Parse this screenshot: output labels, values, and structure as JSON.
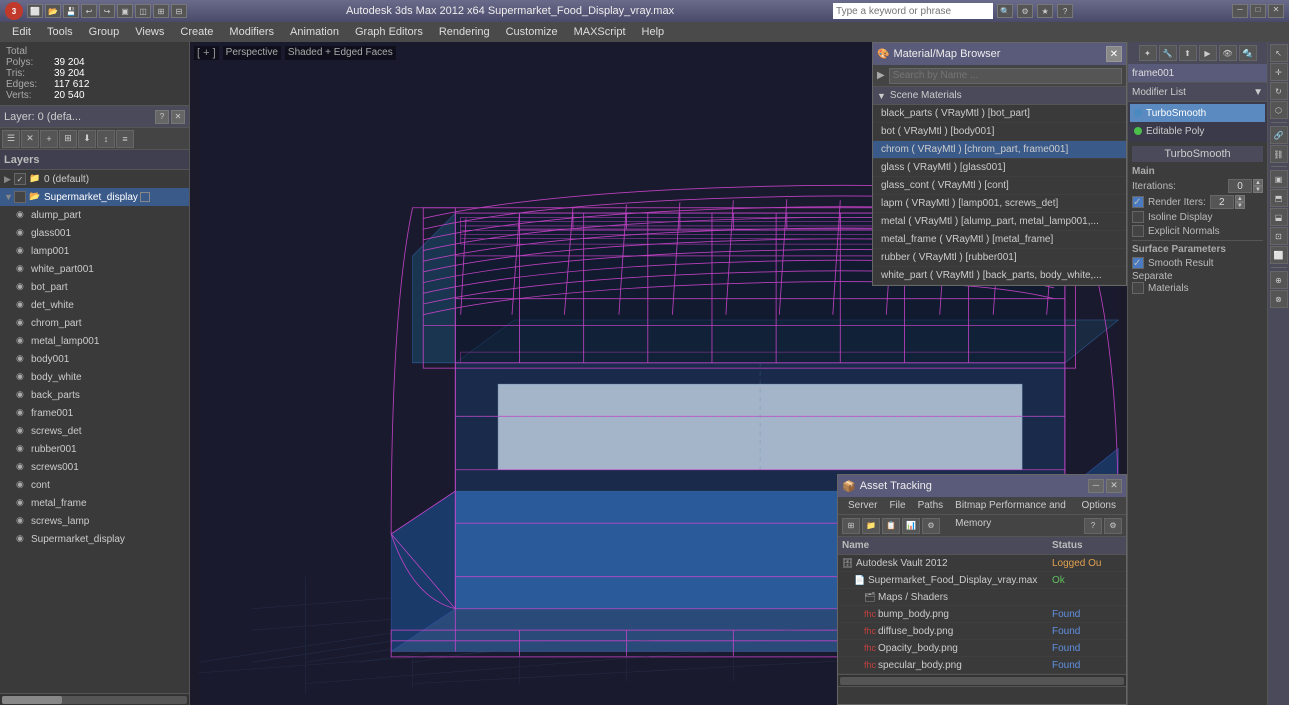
{
  "titlebar": {
    "title": "Autodesk 3ds Max  2012 x64      Supermarket_Food_Display_vray.max",
    "search_placeholder": "Type a keyword or phrase",
    "logo": "3",
    "min_btn": "─",
    "max_btn": "□",
    "close_btn": "✕"
  },
  "menubar": {
    "items": [
      "Edit",
      "Tools",
      "Group",
      "Views",
      "Create",
      "Modifiers",
      "Animation",
      "Graph Editors",
      "Rendering",
      "Customize",
      "MAXScript",
      "Help"
    ]
  },
  "viewport_label": {
    "perspective": "Perspective",
    "shading": "Shaded + Edged Faces",
    "bracket_open": "[ + ]"
  },
  "stats": {
    "total_label": "Total",
    "polys_label": "Polys:",
    "polys_value": "39 204",
    "tris_label": "Tris:",
    "tris_value": "39 204",
    "edges_label": "Edges:",
    "edges_value": "117 612",
    "verts_label": "Verts:",
    "verts_value": "20 540"
  },
  "layers_panel": {
    "title": "Layer: 0 (defa...",
    "question_btn": "?",
    "close_btn": "✕",
    "label": "Layers",
    "toolbar_btns": [
      "☰",
      "✕",
      "+",
      "⊞",
      "⬇",
      "↕",
      "≡"
    ],
    "items": [
      {
        "label": "0 (default)",
        "level": 0,
        "checked": true,
        "selected": false
      },
      {
        "label": "Supermarket_display",
        "level": 0,
        "checked": false,
        "selected": true
      },
      {
        "label": "alump_part",
        "level": 1,
        "checked": false,
        "selected": false
      },
      {
        "label": "glass001",
        "level": 1,
        "checked": false,
        "selected": false
      },
      {
        "label": "lamp001",
        "level": 1,
        "checked": false,
        "selected": false
      },
      {
        "label": "white_part001",
        "level": 1,
        "checked": false,
        "selected": false
      },
      {
        "label": "bot_part",
        "level": 1,
        "checked": false,
        "selected": false
      },
      {
        "label": "det_white",
        "level": 1,
        "checked": false,
        "selected": false
      },
      {
        "label": "chrom_part",
        "level": 1,
        "checked": false,
        "selected": false
      },
      {
        "label": "metal_lamp001",
        "level": 1,
        "checked": false,
        "selected": false
      },
      {
        "label": "body001",
        "level": 1,
        "checked": false,
        "selected": false
      },
      {
        "label": "body_white",
        "level": 1,
        "checked": false,
        "selected": false
      },
      {
        "label": "back_parts",
        "level": 1,
        "checked": false,
        "selected": false
      },
      {
        "label": "frame001",
        "level": 1,
        "checked": false,
        "selected": false
      },
      {
        "label": "screws_det",
        "level": 1,
        "checked": false,
        "selected": false
      },
      {
        "label": "rubber001",
        "level": 1,
        "checked": false,
        "selected": false
      },
      {
        "label": "screws001",
        "level": 1,
        "checked": false,
        "selected": false
      },
      {
        "label": "cont",
        "level": 1,
        "checked": false,
        "selected": false
      },
      {
        "label": "metal_frame",
        "level": 1,
        "checked": false,
        "selected": false
      },
      {
        "label": "screws_lamp",
        "level": 1,
        "checked": false,
        "selected": false
      },
      {
        "label": "Supermarket_display",
        "level": 1,
        "checked": false,
        "selected": false
      }
    ]
  },
  "right_panel": {
    "frame_label": "frame001",
    "modifier_list_label": "Modifier List",
    "modifiers": [
      {
        "label": "TurboSmooth",
        "selected": true,
        "dot_color": "blue"
      },
      {
        "label": "Editable Poly",
        "selected": false,
        "dot_color": "green"
      }
    ],
    "turbosmooth": {
      "title": "TurboSmooth",
      "main_label": "Main",
      "iterations_label": "Iterations:",
      "iterations_value": "0",
      "render_iters_label": "Render Iters:",
      "render_iters_value": "2",
      "isoline_display_label": "Isoline Display",
      "explicit_normals_label": "Explicit Normals",
      "surface_label": "Surface Parameters",
      "smooth_result_label": "Smooth Result",
      "separate_label": "Separate",
      "materials_label": "Materials"
    }
  },
  "mat_browser": {
    "title": "Material/Map Browser",
    "close_btn": "✕",
    "search_placeholder": "Search by Name ...",
    "section_label": "Scene Materials",
    "materials": [
      {
        "label": "black_parts ( VRayMtl ) [bot_part]"
      },
      {
        "label": "bot ( VRayMtl ) [body001]"
      },
      {
        "label": "chrom ( VRayMtl ) [chrom_part, frame001]",
        "selected": true
      },
      {
        "label": "glass ( VRayMtl ) [glass001]"
      },
      {
        "label": "glass_cont ( VRayMtl ) [cont]"
      },
      {
        "label": "lapm ( VRayMtl ) [lamp001, screws_det]"
      },
      {
        "label": "metal ( VRayMtl ) [alump_part, metal_lamp001,..."
      },
      {
        "label": "metal_frame ( VRayMtl ) [metal_frame]"
      },
      {
        "label": "rubber ( VRayMtl ) [rubber001]"
      },
      {
        "label": "white_part ( VRayMtl ) [back_parts, body_white,..."
      }
    ]
  },
  "asset_panel": {
    "title": "Asset Tracking",
    "min_btn": "─",
    "close_btn": "✕",
    "menu_items": [
      "Server",
      "File",
      "Paths",
      "Bitmap Performance and Memory",
      "Options"
    ],
    "col_name": "Name",
    "col_status": "Status",
    "items": [
      {
        "label": "Autodesk Vault 2012",
        "level": 0,
        "icon": "🗄",
        "status": "Logged Ou",
        "status_class": "status-loggedout"
      },
      {
        "label": "Supermarket_Food_Display_vray.max",
        "level": 1,
        "icon": "📄",
        "status": "Ok",
        "status_class": "status-ok"
      },
      {
        "label": "Maps / Shaders",
        "level": 2,
        "icon": "🗂",
        "status": "",
        "status_class": ""
      },
      {
        "label": "bump_body.png",
        "level": 3,
        "icon": "🖼",
        "status": "Found",
        "status_class": "status-found"
      },
      {
        "label": "diffuse_body.png",
        "level": 3,
        "icon": "🖼",
        "status": "Found",
        "status_class": "status-found"
      },
      {
        "label": "Opacity_body.png",
        "level": 3,
        "icon": "🖼",
        "status": "Found",
        "status_class": "status-found"
      },
      {
        "label": "specular_body.png",
        "level": 3,
        "icon": "🖼",
        "status": "Found",
        "status_class": "status-found"
      }
    ]
  }
}
